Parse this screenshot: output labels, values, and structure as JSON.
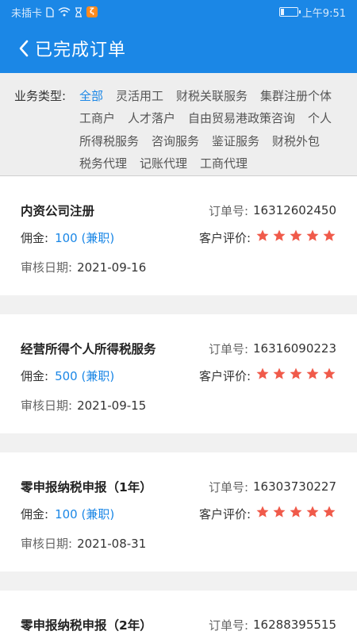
{
  "status_bar": {
    "carrier": "未插卡",
    "time": "上午9:51",
    "icons": [
      "sim-icon",
      "wifi-icon",
      "hourglass-icon",
      "app-badge-icon",
      "battery-icon"
    ]
  },
  "header": {
    "title": "已完成订单",
    "back_icon": "chevron-left-icon"
  },
  "filter": {
    "label": "业务类型:",
    "options": [
      "全部",
      "灵活用工",
      "财税关联服务",
      "集群注册个体",
      "工商户",
      "人才落户",
      "自由贸易港政策咨询",
      "个人",
      "所得税服务",
      "咨询服务",
      "鉴证服务",
      "财税外包",
      "税务代理",
      "记账代理",
      "工商代理"
    ],
    "selected": "全部"
  },
  "labels": {
    "order_no": "订单号:",
    "commission": "佣金:",
    "rating": "客户评价:",
    "review_date": "审核日期:"
  },
  "colors": {
    "primary": "#1b87e6",
    "star": "#f05a4a"
  },
  "orders": [
    {
      "title": "内资公司注册",
      "order_no": "16312602450",
      "commission": "100 (兼职)",
      "rating": 5,
      "review_date": "2021-09-16"
    },
    {
      "title": "经营所得个人所得税服务",
      "order_no": "16316090223",
      "commission": "500 (兼职)",
      "rating": 5,
      "review_date": "2021-09-15"
    },
    {
      "title": "零申报纳税申报（1年）",
      "order_no": "16303730227",
      "commission": "100 (兼职)",
      "rating": 5,
      "review_date": "2021-08-31"
    },
    {
      "title": "零申报纳税申报（2年）",
      "order_no": "16288395515"
    }
  ]
}
